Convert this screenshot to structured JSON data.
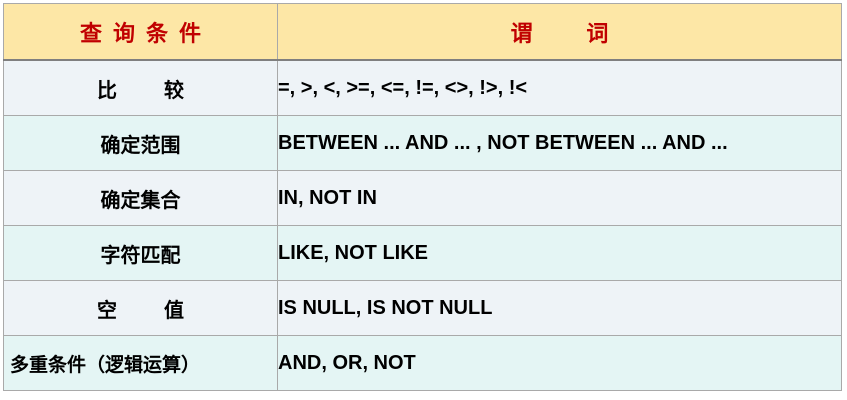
{
  "table": {
    "headers": {
      "condition": "查询条件",
      "predicate": "谓 词"
    },
    "rows": [
      {
        "condition": "比 较",
        "predicate": "=, >, <, >=, <=, !=, <>, !>, !<"
      },
      {
        "condition": "确定范围",
        "predicate": "BETWEEN ... AND ... , NOT BETWEEN ... AND ..."
      },
      {
        "condition": "确定集合",
        "predicate": "IN, NOT IN"
      },
      {
        "condition": "字符匹配",
        "predicate": "LIKE, NOT LIKE"
      },
      {
        "condition": "空 值",
        "predicate": "IS NULL, IS NOT NULL"
      },
      {
        "condition": "多重条件（逻辑运算）",
        "predicate": "AND, OR, NOT"
      }
    ]
  },
  "colors": {
    "header_bg": "#fde7a6",
    "header_text": "#c00000",
    "row_bg_odd": "#eef3f7",
    "row_bg_even": "#e4f5f4"
  }
}
